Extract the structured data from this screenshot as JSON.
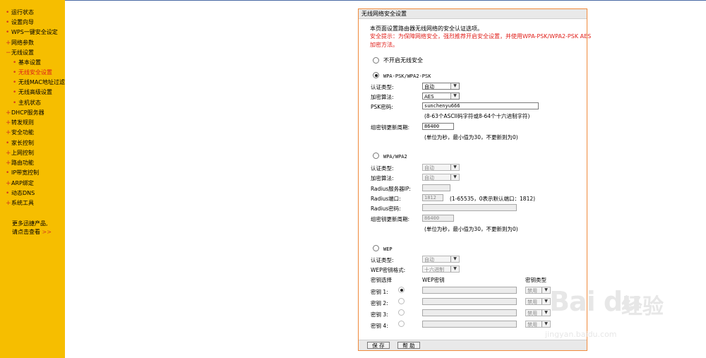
{
  "sidebar": {
    "items": [
      {
        "label": "运行状态"
      },
      {
        "label": "设置向导"
      },
      {
        "label": "WPS一键安全设定"
      },
      {
        "label": "网络参数"
      },
      {
        "label": "无线设置"
      },
      {
        "label": "基本设置"
      },
      {
        "label": "无线安全设置"
      },
      {
        "label": "无线MAC地址过滤"
      },
      {
        "label": "无线高级设置"
      },
      {
        "label": "主机状态"
      },
      {
        "label": "DHCP服务器"
      },
      {
        "label": "转发规则"
      },
      {
        "label": "安全功能"
      },
      {
        "label": "家长控制"
      },
      {
        "label": "上网控制"
      },
      {
        "label": "路由功能"
      },
      {
        "label": "IP带宽控制"
      },
      {
        "label": "ARP绑定"
      },
      {
        "label": "动态DNS"
      },
      {
        "label": "系统工具"
      }
    ],
    "more_line1": "更多迅捷产品,",
    "more_line2": "请点击查看",
    "more_arrow": ">>"
  },
  "panel": {
    "title": "无线网络安全设置",
    "intro": "本页面设置路由器无线网络的安全认证选项。",
    "warning_line1": "安全提示：为保障网络安全，强烈推荐开启安全设置，并使用WPA-PSK/WPA2-PSK AES",
    "warning_line2": "加密方法。",
    "no_security_label": "不开启无线安全",
    "wpa_psk": {
      "label": "WPA-PSK/WPA2-PSK",
      "auth_label": "认证类型:",
      "auth_value": "自动",
      "enc_label": "加密算法:",
      "enc_value": "AES",
      "psk_label": "PSK密码:",
      "psk_value": "sunchenyu666",
      "psk_hint": "(8-63个ASCII码字符或8-64个十六进制字符)",
      "renew_label": "组密钥更新周期:",
      "renew_value": "86400",
      "renew_hint": "(单位为秒，最小值为30，不更新则为0)"
    },
    "wpa": {
      "label": "WPA/WPA2",
      "auth_label": "认证类型:",
      "auth_value": "自动",
      "enc_label": "加密算法:",
      "enc_value": "自动",
      "radius_ip_label": "Radius服务器IP:",
      "radius_ip_value": "",
      "radius_port_label": "Radius端口:",
      "radius_port_value": "1812",
      "radius_port_hint": "(1-65535，0表示默认端口：1812)",
      "radius_pwd_label": "Radius密码:",
      "radius_pwd_value": "",
      "renew_label": "组密钥更新周期:",
      "renew_value": "86400",
      "renew_hint": "(单位为秒，最小值为30，不更新则为0)"
    },
    "wep": {
      "label": "WEP",
      "auth_label": "认证类型:",
      "auth_value": "自动",
      "format_label": "WEP密钥格式:",
      "format_value": "十六进制",
      "col_select": "密钥选择",
      "col_key": "WEP密钥",
      "col_type": "密钥类型",
      "keys": [
        {
          "label": "密钥 1:",
          "value": "",
          "type": "禁用"
        },
        {
          "label": "密钥 2:",
          "value": "",
          "type": "禁用"
        },
        {
          "label": "密钥 3:",
          "value": "",
          "type": "禁用"
        },
        {
          "label": "密钥 4:",
          "value": "",
          "type": "禁用"
        }
      ]
    },
    "save_label": "保 存",
    "help_label": "帮 助"
  },
  "watermark": {
    "logo": "Bai du",
    "brand": "经验",
    "url": "jingyan.baidu.com"
  },
  "colors": {
    "sidebar_bg": "#f6be00",
    "warning": "#e0201b",
    "panel_border": "#f08a3c"
  }
}
